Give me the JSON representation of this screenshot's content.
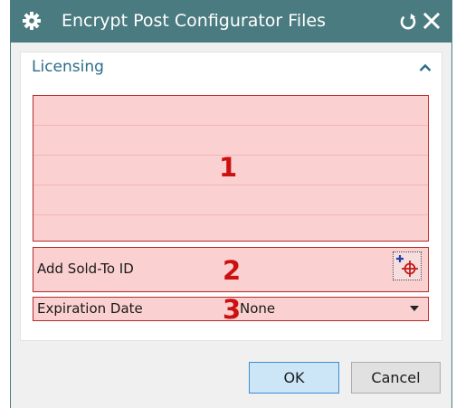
{
  "window": {
    "title": "Encrypt Post Configurator Files",
    "icon": "gear-icon",
    "reset_icon": "reset-icon",
    "close_icon": "close-icon"
  },
  "licensing": {
    "section_title": "Licensing",
    "collapse_icon": "chevron-up-icon",
    "list_badge": "1",
    "sold_to": {
      "label": "Add Sold-To ID",
      "badge": "2",
      "button_icon": "point-picker-icon"
    },
    "expiration": {
      "label": "Expiration Date",
      "badge": "3",
      "value": "None"
    }
  },
  "footer": {
    "ok_label": "OK",
    "cancel_label": "Cancel"
  },
  "colors": {
    "titlebar": "#4a7b80",
    "highlight_fill": "#fbd0d0",
    "highlight_border": "#b72a2a",
    "badge": "#cc1010",
    "section_header": "#2b6d8b",
    "ok_button": "#cde6f7"
  }
}
